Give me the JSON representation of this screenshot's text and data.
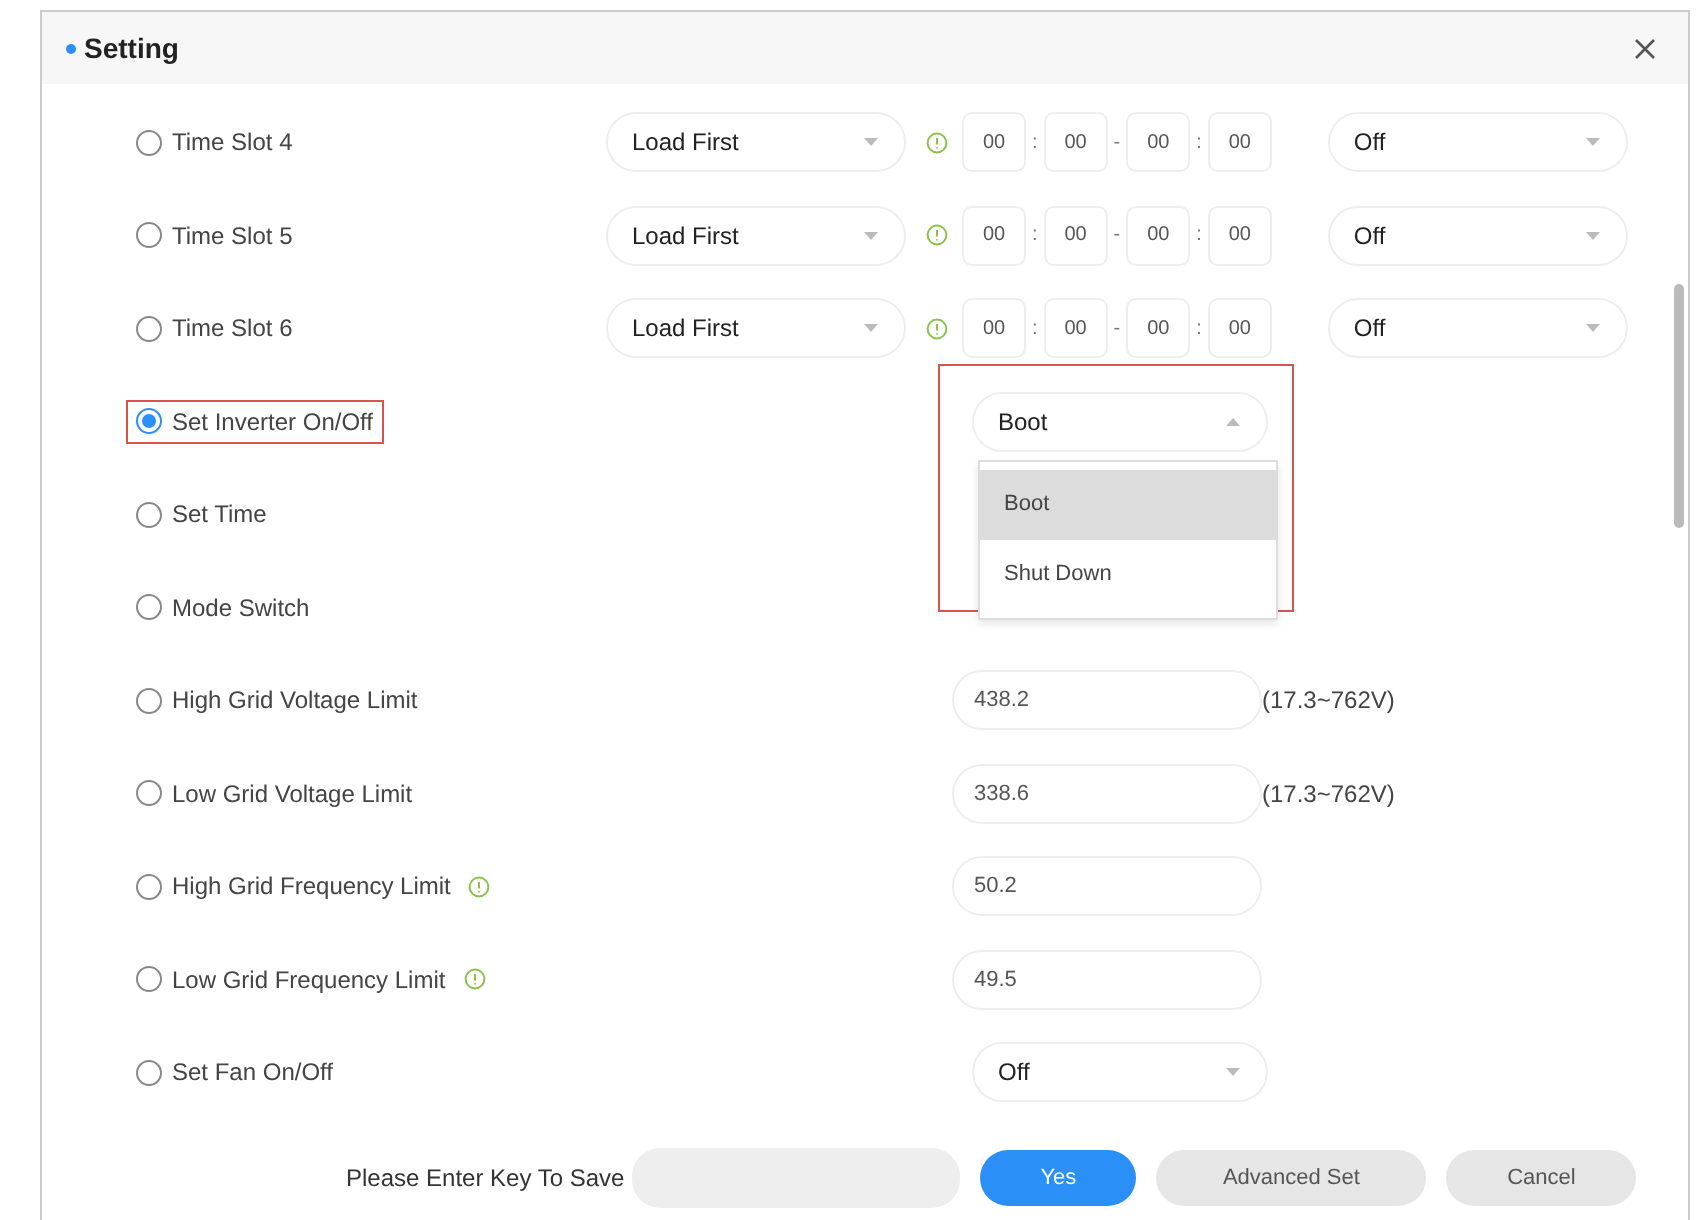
{
  "dialog": {
    "title": "Setting"
  },
  "rows": [
    {
      "kind": "timeslot",
      "label": "Time Slot 4",
      "selected": false,
      "mode": "Load First",
      "times": [
        "00",
        "00",
        "00",
        "00"
      ],
      "separators": [
        ":",
        "-",
        ":"
      ],
      "enable": "Off"
    },
    {
      "kind": "timeslot",
      "label": "Time Slot 5",
      "selected": false,
      "mode": "Load First",
      "times": [
        "00",
        "00",
        "00",
        "00"
      ],
      "separators": [
        ":",
        "-",
        ":"
      ],
      "enable": "Off"
    },
    {
      "kind": "timeslot",
      "label": "Time Slot 6",
      "selected": false,
      "mode": "Load First",
      "times": [
        "00",
        "00",
        "00",
        "00"
      ],
      "separators": [
        ":",
        "-",
        ":"
      ],
      "enable": "Off"
    },
    {
      "kind": "select",
      "label": "Set Inverter On/Off",
      "selected": true,
      "highlight": true,
      "value": "Boot",
      "open": true,
      "options": [
        {
          "label": "Boot",
          "selected": true
        },
        {
          "label": "Shut Down",
          "selected": false
        }
      ]
    },
    {
      "kind": "blank",
      "label": "Set Time",
      "selected": false
    },
    {
      "kind": "blank",
      "label": "Mode Switch",
      "selected": false
    },
    {
      "kind": "input",
      "label": "High Grid Voltage Limit",
      "selected": false,
      "value": "438.2",
      "range": "(17.3~762V)"
    },
    {
      "kind": "input",
      "label": "Low Grid Voltage Limit",
      "selected": false,
      "value": "338.6",
      "range": "(17.3~762V)"
    },
    {
      "kind": "input",
      "label": "High Grid Frequency Limit",
      "selected": false,
      "info": true,
      "value": "50.2"
    },
    {
      "kind": "input",
      "label": "Low Grid Frequency Limit",
      "selected": false,
      "info": true,
      "value": "49.5"
    },
    {
      "kind": "select",
      "label": "Set Fan On/Off",
      "selected": false,
      "value": "Off",
      "open": false
    }
  ],
  "footer": {
    "key_label": "Please Enter Key To Save",
    "buttons": [
      {
        "label": "Yes",
        "kind": "primary"
      },
      {
        "label": "Advanced Set",
        "kind": "secondary"
      },
      {
        "label": "Cancel",
        "kind": "secondary"
      }
    ]
  }
}
